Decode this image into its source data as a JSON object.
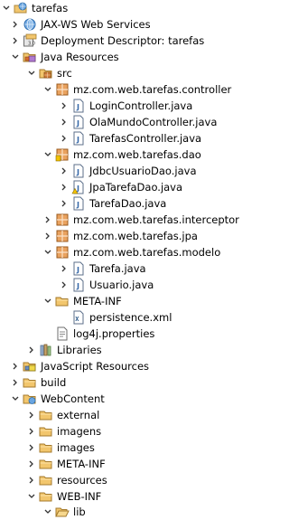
{
  "tree": [
    {
      "id": "r0",
      "label": "tarefas",
      "depth": 0,
      "twisty": "expanded",
      "icon": "web-project-icon"
    },
    {
      "id": "r1",
      "label": "JAX-WS Web Services",
      "depth": 1,
      "twisty": "collapsed",
      "icon": "web-services-icon"
    },
    {
      "id": "r2",
      "label": "Deployment Descriptor: tarefas",
      "depth": 1,
      "twisty": "collapsed",
      "icon": "deployment-descriptor-icon"
    },
    {
      "id": "r3",
      "label": "Java Resources",
      "depth": 1,
      "twisty": "expanded",
      "icon": "java-resources-icon"
    },
    {
      "id": "r4",
      "label": "src",
      "depth": 2,
      "twisty": "expanded",
      "icon": "source-folder-icon"
    },
    {
      "id": "r5",
      "label": "mz.com.web.tarefas.controller",
      "depth": 3,
      "twisty": "expanded",
      "icon": "package-icon"
    },
    {
      "id": "r6",
      "label": "LoginController.java",
      "depth": 4,
      "twisty": "collapsed",
      "icon": "java-file-icon"
    },
    {
      "id": "r7",
      "label": "OlaMundoController.java",
      "depth": 4,
      "twisty": "collapsed",
      "icon": "java-file-icon"
    },
    {
      "id": "r8",
      "label": "TarefasController.java",
      "depth": 4,
      "twisty": "collapsed",
      "icon": "java-file-icon"
    },
    {
      "id": "r9",
      "label": "mz.com.web.tarefas.dao",
      "depth": 3,
      "twisty": "expanded",
      "icon": "package-icon"
    },
    {
      "id": "r10",
      "label": "JdbcUsuarioDao.java",
      "depth": 4,
      "twisty": "collapsed",
      "icon": "java-file-icon"
    },
    {
      "id": "r11",
      "label": "JpaTarefaDao.java",
      "depth": 4,
      "twisty": "collapsed",
      "icon": "java-file-warning-icon"
    },
    {
      "id": "r12",
      "label": "TarefaDao.java",
      "depth": 4,
      "twisty": "collapsed",
      "icon": "java-file-icon"
    },
    {
      "id": "r13",
      "label": "mz.com.web.tarefas.interceptor",
      "depth": 3,
      "twisty": "collapsed",
      "icon": "package-icon"
    },
    {
      "id": "r14",
      "label": "mz.com.web.tarefas.jpa",
      "depth": 3,
      "twisty": "collapsed",
      "icon": "package-icon"
    },
    {
      "id": "r15",
      "label": "mz.com.web.tarefas.modelo",
      "depth": 3,
      "twisty": "expanded",
      "icon": "package-icon"
    },
    {
      "id": "r16",
      "label": "Tarefa.java",
      "depth": 4,
      "twisty": "collapsed",
      "icon": "java-file-icon"
    },
    {
      "id": "r17",
      "label": "Usuario.java",
      "depth": 4,
      "twisty": "collapsed",
      "icon": "java-file-icon"
    },
    {
      "id": "r18",
      "label": "META-INF",
      "depth": 3,
      "twisty": "expanded",
      "icon": "folder-icon"
    },
    {
      "id": "r19",
      "label": "persistence.xml",
      "depth": 4,
      "twisty": "none",
      "icon": "xml-file-icon"
    },
    {
      "id": "r20",
      "label": "log4j.properties",
      "depth": 3,
      "twisty": "none",
      "icon": "properties-file-icon"
    },
    {
      "id": "r21",
      "label": "Libraries",
      "depth": 2,
      "twisty": "collapsed",
      "icon": "libraries-icon"
    },
    {
      "id": "r22",
      "label": "JavaScript Resources",
      "depth": 1,
      "twisty": "collapsed",
      "icon": "javascript-resources-icon"
    },
    {
      "id": "r23",
      "label": "build",
      "depth": 1,
      "twisty": "collapsed",
      "icon": "folder-icon"
    },
    {
      "id": "r24",
      "label": "WebContent",
      "depth": 1,
      "twisty": "expanded",
      "icon": "web-folder-icon"
    },
    {
      "id": "r25",
      "label": "external",
      "depth": 2,
      "twisty": "collapsed",
      "icon": "folder-icon"
    },
    {
      "id": "r26",
      "label": "imagens",
      "depth": 2,
      "twisty": "collapsed",
      "icon": "folder-icon"
    },
    {
      "id": "r27",
      "label": "images",
      "depth": 2,
      "twisty": "collapsed",
      "icon": "folder-icon"
    },
    {
      "id": "r28",
      "label": "META-INF",
      "depth": 2,
      "twisty": "collapsed",
      "icon": "folder-icon"
    },
    {
      "id": "r29",
      "label": "resources",
      "depth": 2,
      "twisty": "collapsed",
      "icon": "folder-icon"
    },
    {
      "id": "r30",
      "label": "WEB-INF",
      "depth": 2,
      "twisty": "expanded",
      "icon": "folder-icon"
    },
    {
      "id": "r31",
      "label": "lib",
      "depth": 3,
      "twisty": "expanded",
      "icon": "folder-open-icon"
    }
  ]
}
